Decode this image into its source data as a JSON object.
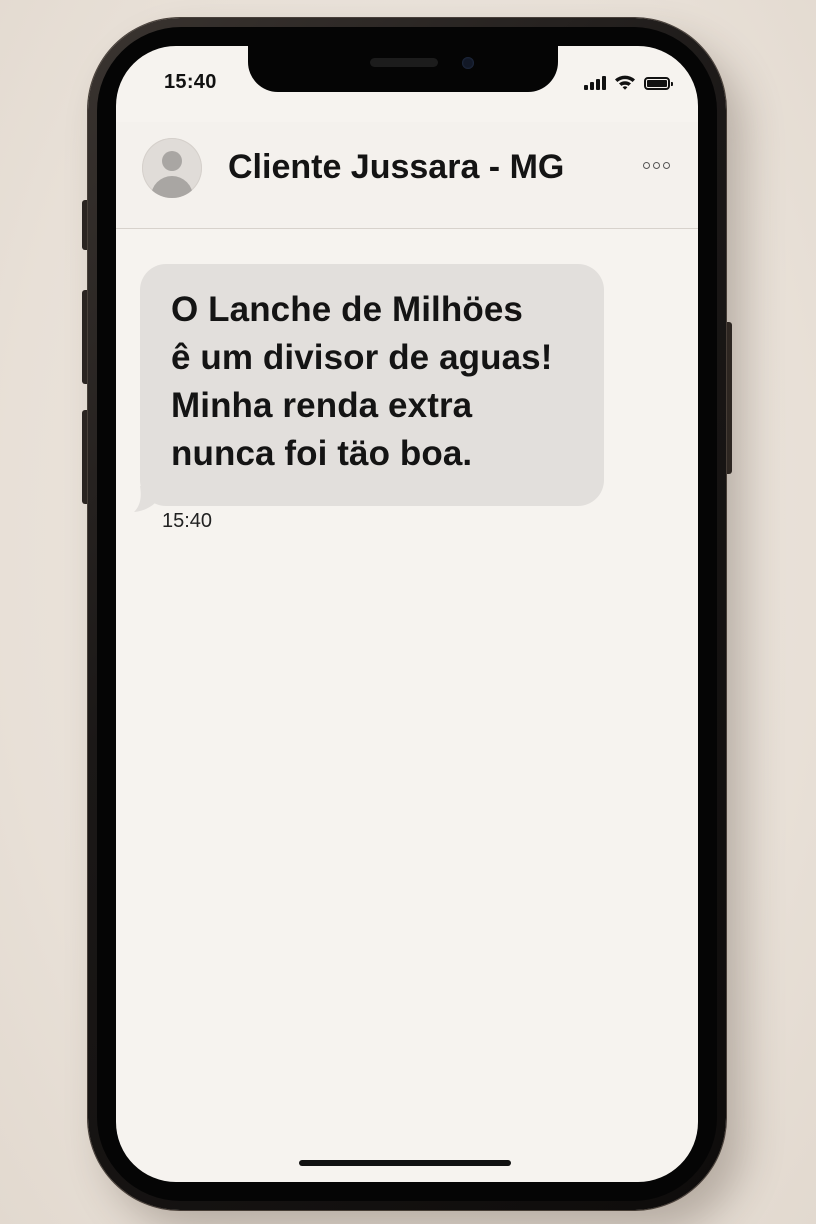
{
  "status_bar": {
    "time": "15:40",
    "icons": [
      "signal-icon",
      "wifi-icon",
      "battery-icon"
    ]
  },
  "header": {
    "contact_name": "Cliente Jussara - MG",
    "avatar_icon": "person-placeholder-icon",
    "more_icon": "more-options-icon"
  },
  "messages": [
    {
      "direction": "incoming",
      "text": "O Lanche de Milhöes\nê um divisor de aguas!\nMinha renda extra\nnunca foi täo boa.",
      "time": "15:40"
    }
  ],
  "colors": {
    "background": "#ebe4dc",
    "screen": "#f6f3ef",
    "incoming_bubble": "#e2dfdc",
    "text": "#141414"
  }
}
